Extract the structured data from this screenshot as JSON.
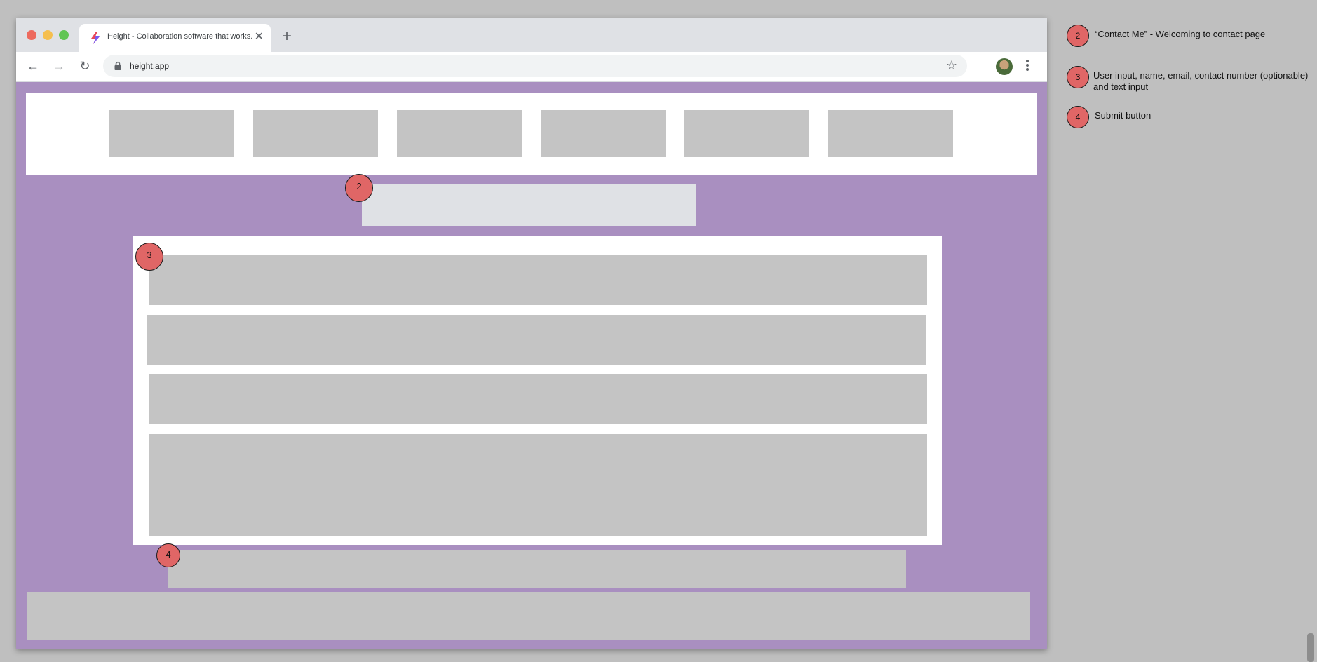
{
  "browser": {
    "tab_title": "Height - Collaboration software that works.",
    "tab_close": "✕",
    "new_tab": "+",
    "url": "height.app",
    "nav": {
      "back": "←",
      "forward": "→",
      "reload": "↻"
    },
    "star": "☆"
  },
  "annotations": {
    "badge_2": "2",
    "badge_3": "3",
    "badge_4": "4"
  },
  "legend": [
    {
      "number": "2",
      "text": "“Contact Me” - Welcoming to contact page"
    },
    {
      "number": "3",
      "text": "User input, name, email, contact number (optionable) and text input"
    },
    {
      "number": "4",
      "text": "Submit button"
    }
  ],
  "colors": {
    "page_background": "#a98fc0",
    "placeholder_block": "#c4c4c4",
    "annotation_badge": "#e06666"
  },
  "icons": [
    "favicon-icon",
    "lock-icon",
    "star-icon",
    "kebab-menu-icon",
    "back-arrow-icon",
    "forward-arrow-icon",
    "reload-icon"
  ]
}
